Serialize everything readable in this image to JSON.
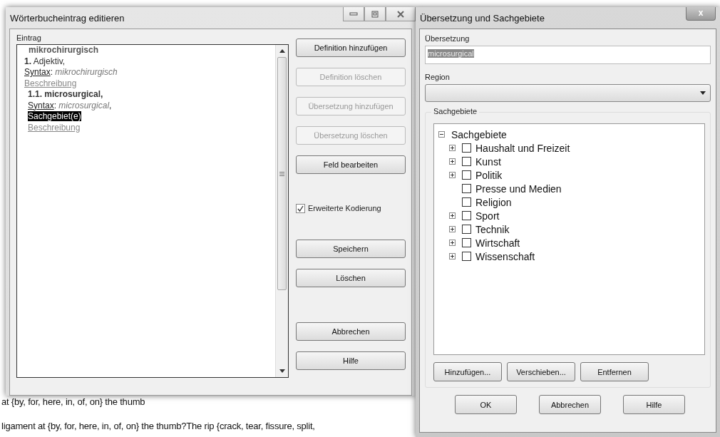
{
  "background_document": {
    "lines": [
      "at {by, for, here, in, of, on} the thumb",
      "ligament at {by, for, here, in, of, on} the thumb?The rip {crack, tear, fissure, split,"
    ]
  },
  "entry_window": {
    "title": "Wörterbucheintrag editieren",
    "entry_label": "Eintrag",
    "entry": {
      "headword": "mikrochirurgisch",
      "definitions": [
        {
          "heading": "**1.** Adjektiv,",
          "syntax_label": "Syntax",
          "syntax_colon": ":",
          "syntax_value": "mikrochirurgisch",
          "description": "Beschreibung",
          "translations": [
            {
              "heading": "1.1. microsurgical,",
              "syntax_label": "Syntax",
              "syntax_colon": ":",
              "syntax_value": "microsurgical",
              "syntax_suffix": ",",
              "subject": "Sachgebiet(e)",
              "subject_selected": true,
              "description": "Beschreibung"
            }
          ]
        }
      ]
    },
    "buttons": [
      {
        "label": "Definition hinzufügen",
        "disabled": false,
        "kind": "button"
      },
      {
        "label": "Definition löschen",
        "disabled": true,
        "kind": "button"
      },
      {
        "label": "Übersetzung hinzufügen",
        "disabled": true,
        "kind": "button"
      },
      {
        "label": "Übersetzung löschen",
        "disabled": true,
        "kind": "button"
      },
      {
        "label": "Feld bearbeiten",
        "disabled": false,
        "kind": "button"
      },
      {
        "label": "Erweiterte Kodierung",
        "checked": true,
        "kind": "checkbox"
      },
      {
        "label": "Speichern",
        "disabled": false,
        "kind": "button"
      },
      {
        "label": "Löschen",
        "disabled": false,
        "kind": "button"
      },
      {
        "label": "Abbrechen",
        "disabled": false,
        "kind": "button"
      },
      {
        "label": "Hilfe",
        "disabled": false,
        "kind": "button"
      }
    ]
  },
  "translation_dialog": {
    "title": "Übersetzung und Sachgebiete",
    "close": "x",
    "translation_label": "Übersetzung",
    "translation_value": "microsurgical",
    "region_label": "Region",
    "subjects_group": "Sachgebiete",
    "tree": {
      "label": "Sachgebiete",
      "expanded": true,
      "children": [
        {
          "label": "Haushalt und Freizeit",
          "has_children": true,
          "checked": false
        },
        {
          "label": "Kunst",
          "has_children": true,
          "checked": false
        },
        {
          "label": "Politik",
          "has_children": true,
          "checked": false
        },
        {
          "label": "Presse und Medien",
          "has_children": false,
          "checked": false
        },
        {
          "label": "Religion",
          "has_children": false,
          "checked": false
        },
        {
          "label": "Sport",
          "has_children": true,
          "checked": false
        },
        {
          "label": "Technik",
          "has_children": true,
          "checked": false
        },
        {
          "label": "Wirtschaft",
          "has_children": true,
          "checked": false
        },
        {
          "label": "Wissenschaft",
          "has_children": true,
          "checked": false
        }
      ]
    },
    "group_buttons": [
      "Hinzufügen...",
      "Verschieben...",
      "Entfernen"
    ],
    "dialog_buttons": [
      "OK",
      "Abbrechen",
      "Hilfe"
    ]
  }
}
